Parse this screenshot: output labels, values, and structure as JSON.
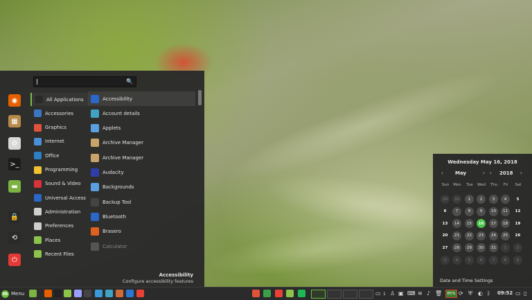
{
  "search": {
    "placeholder": ""
  },
  "favorites": [
    {
      "name": "firefox",
      "icon": "firefox-icon",
      "color": "#e66000",
      "glyph": "◉"
    },
    {
      "name": "files-manager",
      "icon": "package-icon",
      "color": "#b78a4a",
      "glyph": "▦"
    },
    {
      "name": "settings",
      "icon": "settings-icon",
      "color": "#d8d8d8",
      "glyph": "⚙"
    },
    {
      "name": "terminal",
      "icon": "terminal-icon",
      "color": "#1b1b1b",
      "glyph": ">_"
    },
    {
      "name": "folder",
      "icon": "folder-icon",
      "color": "#7cb342",
      "glyph": "▬"
    },
    {
      "name": "lock-screen",
      "icon": "lock-icon",
      "color": "#2a2a2a",
      "glyph": "🔒"
    },
    {
      "name": "logout",
      "icon": "logout-icon",
      "color": "#2a2a2a",
      "glyph": "⟲"
    },
    {
      "name": "shutdown",
      "icon": "power-icon",
      "color": "#e53935",
      "glyph": "⏻"
    }
  ],
  "categories": [
    {
      "label": "All Applications",
      "icon": "all-apps-icon",
      "color": "#2a2a2a",
      "active": true
    },
    {
      "label": "Accessories",
      "icon": "accessories-icon",
      "color": "#3a76c4"
    },
    {
      "label": "Graphics",
      "icon": "graphics-icon",
      "color": "#e0533a"
    },
    {
      "label": "Internet",
      "icon": "internet-icon",
      "color": "#4a90d9"
    },
    {
      "label": "Office",
      "icon": "office-icon",
      "color": "#2d7ec4"
    },
    {
      "label": "Programming",
      "icon": "programming-icon",
      "color": "#f2c230"
    },
    {
      "label": "Sound & Video",
      "icon": "sound-video-icon",
      "color": "#d9323a"
    },
    {
      "label": "Universal Access",
      "icon": "universal-access-icon",
      "color": "#2a67c8"
    },
    {
      "label": "Administration",
      "icon": "administration-icon",
      "color": "#cfcfcf"
    },
    {
      "label": "Preferences",
      "icon": "preferences-icon",
      "color": "#cfcfcf"
    },
    {
      "label": "Places",
      "icon": "places-icon",
      "color": "#8cc34a"
    },
    {
      "label": "Recent Files",
      "icon": "recent-files-icon",
      "color": "#8cc34a"
    }
  ],
  "apps": [
    {
      "label": "Accessibility",
      "icon": "accessibility-icon",
      "color": "#2a67c8",
      "highlight": true
    },
    {
      "label": "Account details",
      "icon": "account-icon",
      "color": "#3fa3c4"
    },
    {
      "label": "Applets",
      "icon": "applets-icon",
      "color": "#5aa0e0"
    },
    {
      "label": "Archive Manager",
      "icon": "archive-icon",
      "color": "#c9a46a"
    },
    {
      "label": "Archive Manager",
      "icon": "archive-icon",
      "color": "#c9a46a"
    },
    {
      "label": "Audacity",
      "icon": "audacity-icon",
      "color": "#2d3ea8"
    },
    {
      "label": "Backgrounds",
      "icon": "backgrounds-icon",
      "color": "#5aa0e0"
    },
    {
      "label": "Backup Tool",
      "icon": "backup-icon",
      "color": "#444444"
    },
    {
      "label": "Bluetooth",
      "icon": "bluetooth-icon",
      "color": "#2a67c8"
    },
    {
      "label": "Brasero",
      "icon": "brasero-icon",
      "color": "#e06020"
    },
    {
      "label": "Calculator",
      "icon": "calculator-icon",
      "color": "#555555",
      "dim": true
    }
  ],
  "description": {
    "title": "Accessibility",
    "subtitle": "Configure accessibility features"
  },
  "calendar": {
    "date_line": "Wednesday May 16, 2018",
    "month": "May",
    "year": "2018",
    "weekdays": [
      "Sun",
      "Mon",
      "Tue",
      "Wed",
      "Thu",
      "Fri",
      "Sat"
    ],
    "weeks": [
      [
        [
          "29",
          "o"
        ],
        [
          "30",
          "o"
        ],
        [
          "1",
          "n"
        ],
        [
          "2",
          "n"
        ],
        [
          "3",
          "n"
        ],
        [
          "4",
          "n"
        ],
        [
          "5",
          "w"
        ]
      ],
      [
        [
          "6",
          "w"
        ],
        [
          "7",
          "n"
        ],
        [
          "8",
          "n"
        ],
        [
          "9",
          "n"
        ],
        [
          "10",
          "n"
        ],
        [
          "11",
          "n"
        ],
        [
          "12",
          "w"
        ]
      ],
      [
        [
          "13",
          "w"
        ],
        [
          "14",
          "n"
        ],
        [
          "15",
          "n"
        ],
        [
          "16",
          "t"
        ],
        [
          "17",
          "n"
        ],
        [
          "18",
          "n"
        ],
        [
          "19",
          "w"
        ]
      ],
      [
        [
          "20",
          "w"
        ],
        [
          "21",
          "n"
        ],
        [
          "22",
          "n"
        ],
        [
          "23",
          "n"
        ],
        [
          "24",
          "n"
        ],
        [
          "25",
          "n"
        ],
        [
          "26",
          "w"
        ]
      ],
      [
        [
          "27",
          "w"
        ],
        [
          "28",
          "n"
        ],
        [
          "29",
          "n"
        ],
        [
          "30",
          "n"
        ],
        [
          "31",
          "n"
        ],
        [
          "1",
          "o"
        ],
        [
          "2",
          "o"
        ]
      ],
      [
        [
          "3",
          "o"
        ],
        [
          "4",
          "o"
        ],
        [
          "5",
          "o"
        ],
        [
          "6",
          "o"
        ],
        [
          "7",
          "o"
        ],
        [
          "8",
          "o"
        ],
        [
          "9",
          "o"
        ]
      ]
    ],
    "settings_label": "Date and Time Settings"
  },
  "taskbar": {
    "menu_label": "Menu",
    "battery": "85%",
    "clock": "09:52",
    "tray_count": "1",
    "colors": {
      "accent": "#6cbf3f",
      "battery_border": "#d43a2a"
    }
  },
  "launchers": [
    {
      "icon": "show-desktop-icon",
      "color": "#7cb342"
    },
    {
      "icon": "firefox-icon",
      "color": "#e66000"
    },
    {
      "icon": "terminal-icon",
      "color": "#222222"
    },
    {
      "icon": "files-icon",
      "color": "#8cc34a"
    },
    {
      "icon": "text-editor-icon",
      "color": "#9aa0ff"
    },
    {
      "icon": "system-monitor-icon",
      "color": "#444444"
    },
    {
      "icon": "image-viewer-icon",
      "color": "#3a9ad9"
    },
    {
      "icon": "store-icon",
      "color": "#3fa3c4"
    },
    {
      "icon": "package-icon",
      "color": "#cf6b3b"
    },
    {
      "icon": "browser-icon",
      "color": "#2a77d4"
    },
    {
      "icon": "chrome-icon",
      "color": "#e94235"
    }
  ],
  "task_apps": [
    {
      "icon": "graphics-app-icon",
      "color": "#e0533a"
    },
    {
      "icon": "software-center-icon",
      "color": "#3aa04a"
    },
    {
      "icon": "chrome-icon",
      "color": "#e94235"
    },
    {
      "icon": "files-icon",
      "color": "#8cc34a"
    },
    {
      "icon": "spotify-icon",
      "color": "#1db954"
    }
  ]
}
